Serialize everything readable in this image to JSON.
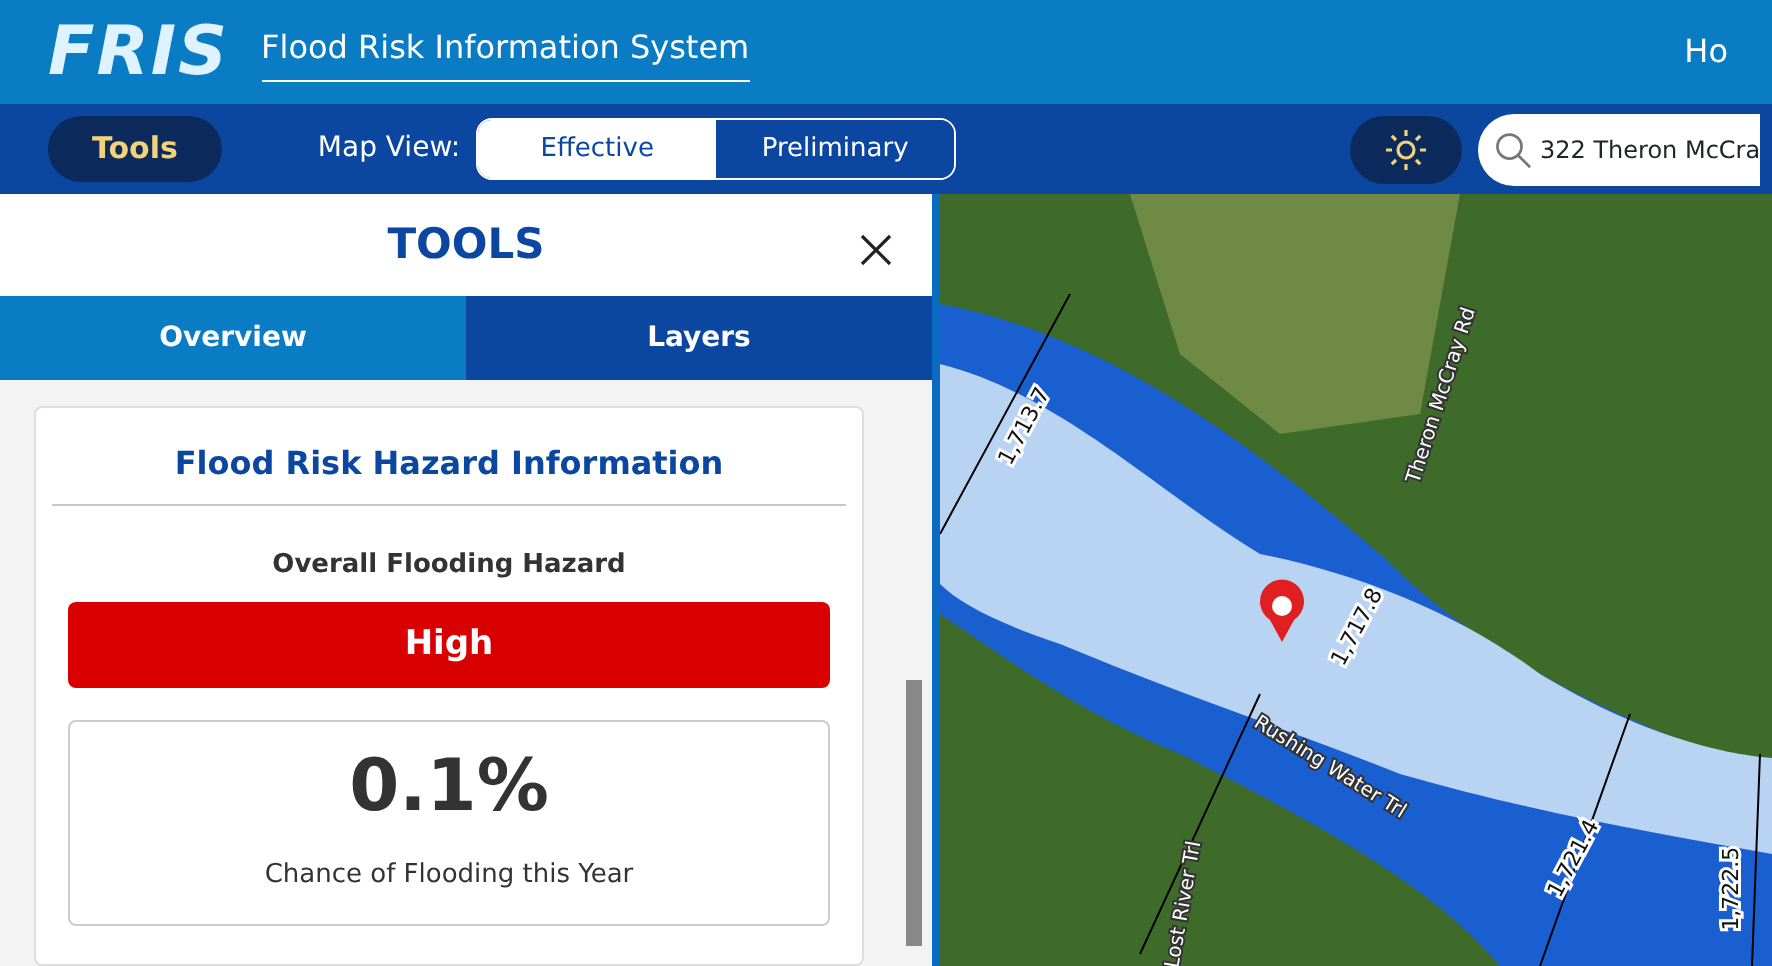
{
  "header": {
    "logo": "FRIS",
    "title": "Flood Risk Information System",
    "nav_link": "Ho"
  },
  "toolbar": {
    "tools_button": "Tools",
    "map_view_label": "Map View:",
    "map_views": [
      {
        "label": "Effective",
        "selected": true
      },
      {
        "label": "Preliminary",
        "selected": false
      }
    ],
    "search": {
      "value": "322 Theron McCra"
    }
  },
  "tools_panel": {
    "title": "TOOLS",
    "tabs": [
      {
        "label": "Overview",
        "selected": true
      },
      {
        "label": "Layers",
        "selected": false
      }
    ],
    "card": {
      "title": "Flood Risk Hazard Information",
      "hazard_label": "Overall Flooding Hazard",
      "hazard_level": "High",
      "chance_value": "0.1%",
      "chance_label": "Chance of Flooding this Year"
    }
  },
  "map": {
    "labels": [
      {
        "kind": "elevation",
        "text": "1,713.7"
      },
      {
        "kind": "elevation",
        "text": "1,717.8"
      },
      {
        "kind": "elevation",
        "text": "1,721.4"
      },
      {
        "kind": "elevation",
        "text": "1,722.5"
      },
      {
        "kind": "road",
        "text": "Theron McCray Rd"
      },
      {
        "kind": "road",
        "text": "Rushing Water Trl"
      },
      {
        "kind": "road",
        "text": "Lost River Trl"
      }
    ]
  }
}
